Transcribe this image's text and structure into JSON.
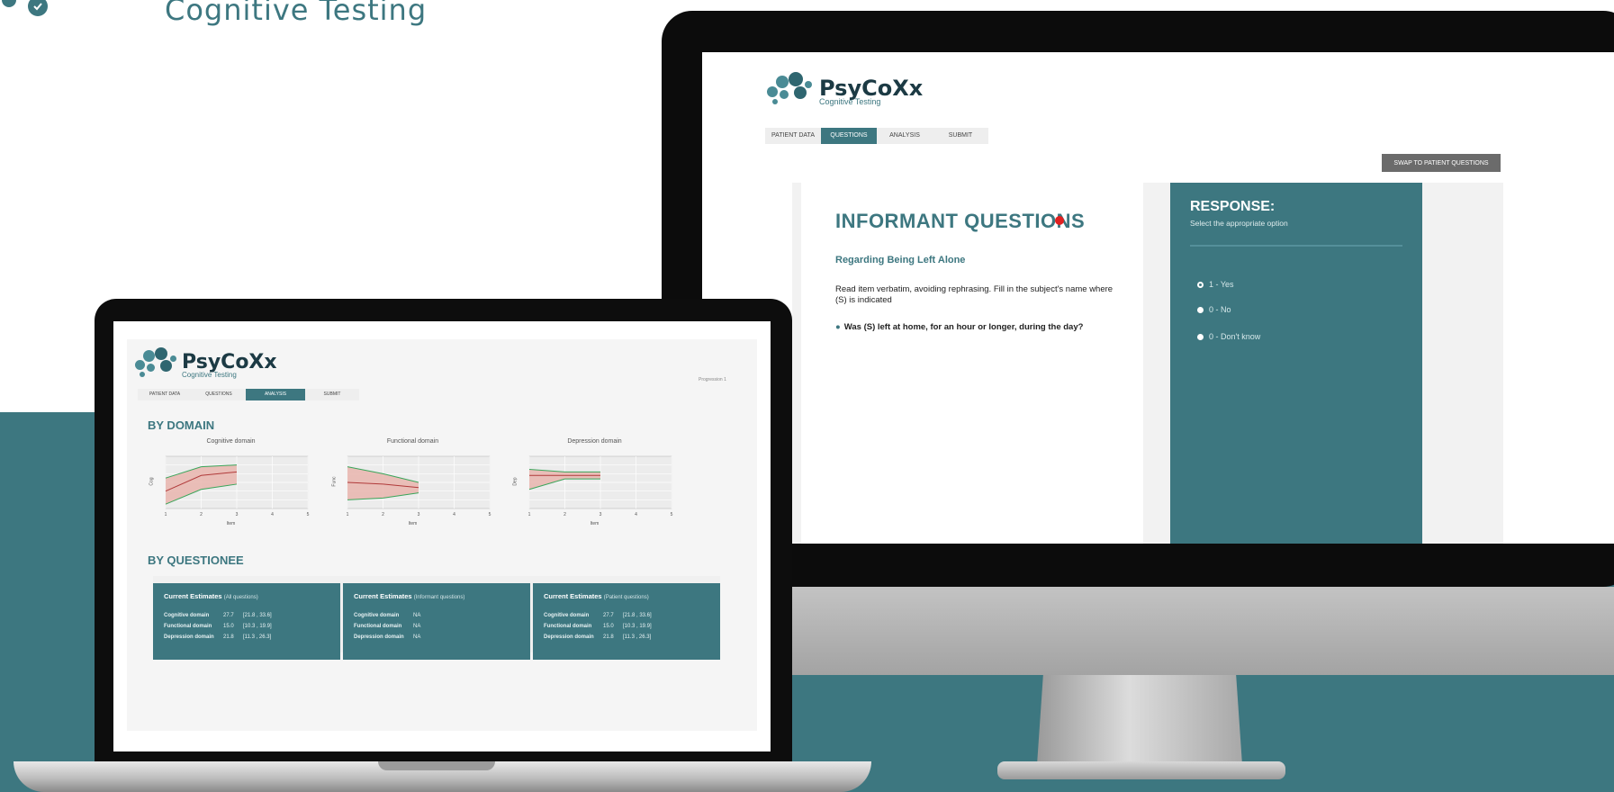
{
  "page_tagline": "Cognitive Testing",
  "desktop": {
    "logo": {
      "name": "PsyCoXx",
      "subtitle": "Cognitive Testing"
    },
    "tabs": [
      {
        "label": "PATIENT DATA",
        "active": false
      },
      {
        "label": "QUESTIONS",
        "active": true
      },
      {
        "label": "ANALYSIS",
        "active": false
      },
      {
        "label": "SUBMIT",
        "active": false
      }
    ],
    "swap_button": "SWAP TO PATIENT QUESTIONS",
    "question": {
      "title": "INFORMANT QUESTIONS",
      "status_color": "#e02020",
      "section": "Regarding Being Left Alone",
      "instruction": "Read item verbatim, avoiding rephrasing. Fill in the subject's name where (S) is indicated",
      "text": "Was (S) left at home, for an hour or longer, during the day?"
    },
    "response": {
      "title": "RESPONSE:",
      "subtitle": "Select the appropriate option",
      "options": [
        {
          "label": "1 - Yes",
          "selected": true
        },
        {
          "label": "0 - No",
          "selected": false
        },
        {
          "label": "0 - Don't know",
          "selected": false
        }
      ]
    }
  },
  "laptop": {
    "logo": {
      "name": "PsyCoXx",
      "subtitle": "Cognitive Testing"
    },
    "tabs": [
      {
        "label": "PATIENT DATA",
        "active": false
      },
      {
        "label": "QUESTIONS",
        "active": false
      },
      {
        "label": "ANALYSIS",
        "active": true
      },
      {
        "label": "SUBMIT",
        "active": false
      }
    ],
    "progress_text": "Progression 1",
    "by_domain": "BY DOMAIN",
    "by_questionee": "BY QUESTIONEE",
    "charts": [
      {
        "title": "Cognitive domain",
        "ylabel": "Cog",
        "xlabel": "Item",
        "x": [
          1,
          2,
          3
        ],
        "upper": [
          35,
          48,
          50
        ],
        "estimate": [
          20,
          38,
          42
        ],
        "lower": [
          5,
          22,
          28
        ]
      },
      {
        "title": "Functional domain",
        "ylabel": "Func",
        "xlabel": "Item",
        "x": [
          1,
          2,
          3
        ],
        "upper": [
          48,
          40,
          30
        ],
        "estimate": [
          30,
          28,
          24
        ],
        "lower": [
          10,
          12,
          18
        ]
      },
      {
        "title": "Depression domain",
        "ylabel": "Dep",
        "xlabel": "Item",
        "x": [
          1,
          2,
          3
        ],
        "upper": [
          45,
          42,
          42
        ],
        "estimate": [
          38,
          38,
          38
        ],
        "lower": [
          22,
          34,
          34
        ]
      }
    ],
    "estimates": [
      {
        "title": "Current Estimates",
        "scope": "(All questions)",
        "rows": [
          {
            "label": "Cognitive domain",
            "value": "27.7",
            "ci": "[21.8 , 33.6]"
          },
          {
            "label": "Functional domain",
            "value": "15.0",
            "ci": "[10.3 , 19.9]"
          },
          {
            "label": "Depression domain",
            "value": "21.8",
            "ci": "[11.3 , 26.3]"
          }
        ]
      },
      {
        "title": "Current Estimates",
        "scope": "(Informant questions)",
        "rows": [
          {
            "label": "Cognitive domain",
            "value": "NA",
            "ci": ""
          },
          {
            "label": "Functional domain",
            "value": "NA",
            "ci": ""
          },
          {
            "label": "Depression domain",
            "value": "NA",
            "ci": ""
          }
        ]
      },
      {
        "title": "Current Estimates",
        "scope": "(Patient questions)",
        "rows": [
          {
            "label": "Cognitive domain",
            "value": "27.7",
            "ci": "[21.8 , 33.6]"
          },
          {
            "label": "Functional domain",
            "value": "15.0",
            "ci": "[10.3 , 19.9]"
          },
          {
            "label": "Depression domain",
            "value": "21.8",
            "ci": "[11.3 , 26.3]"
          }
        ]
      }
    ]
  },
  "colors": {
    "teal": "#3d7780",
    "band_red": "#e9b5ae",
    "line_red": "#b03a3a",
    "line_green": "#3aa55a"
  }
}
